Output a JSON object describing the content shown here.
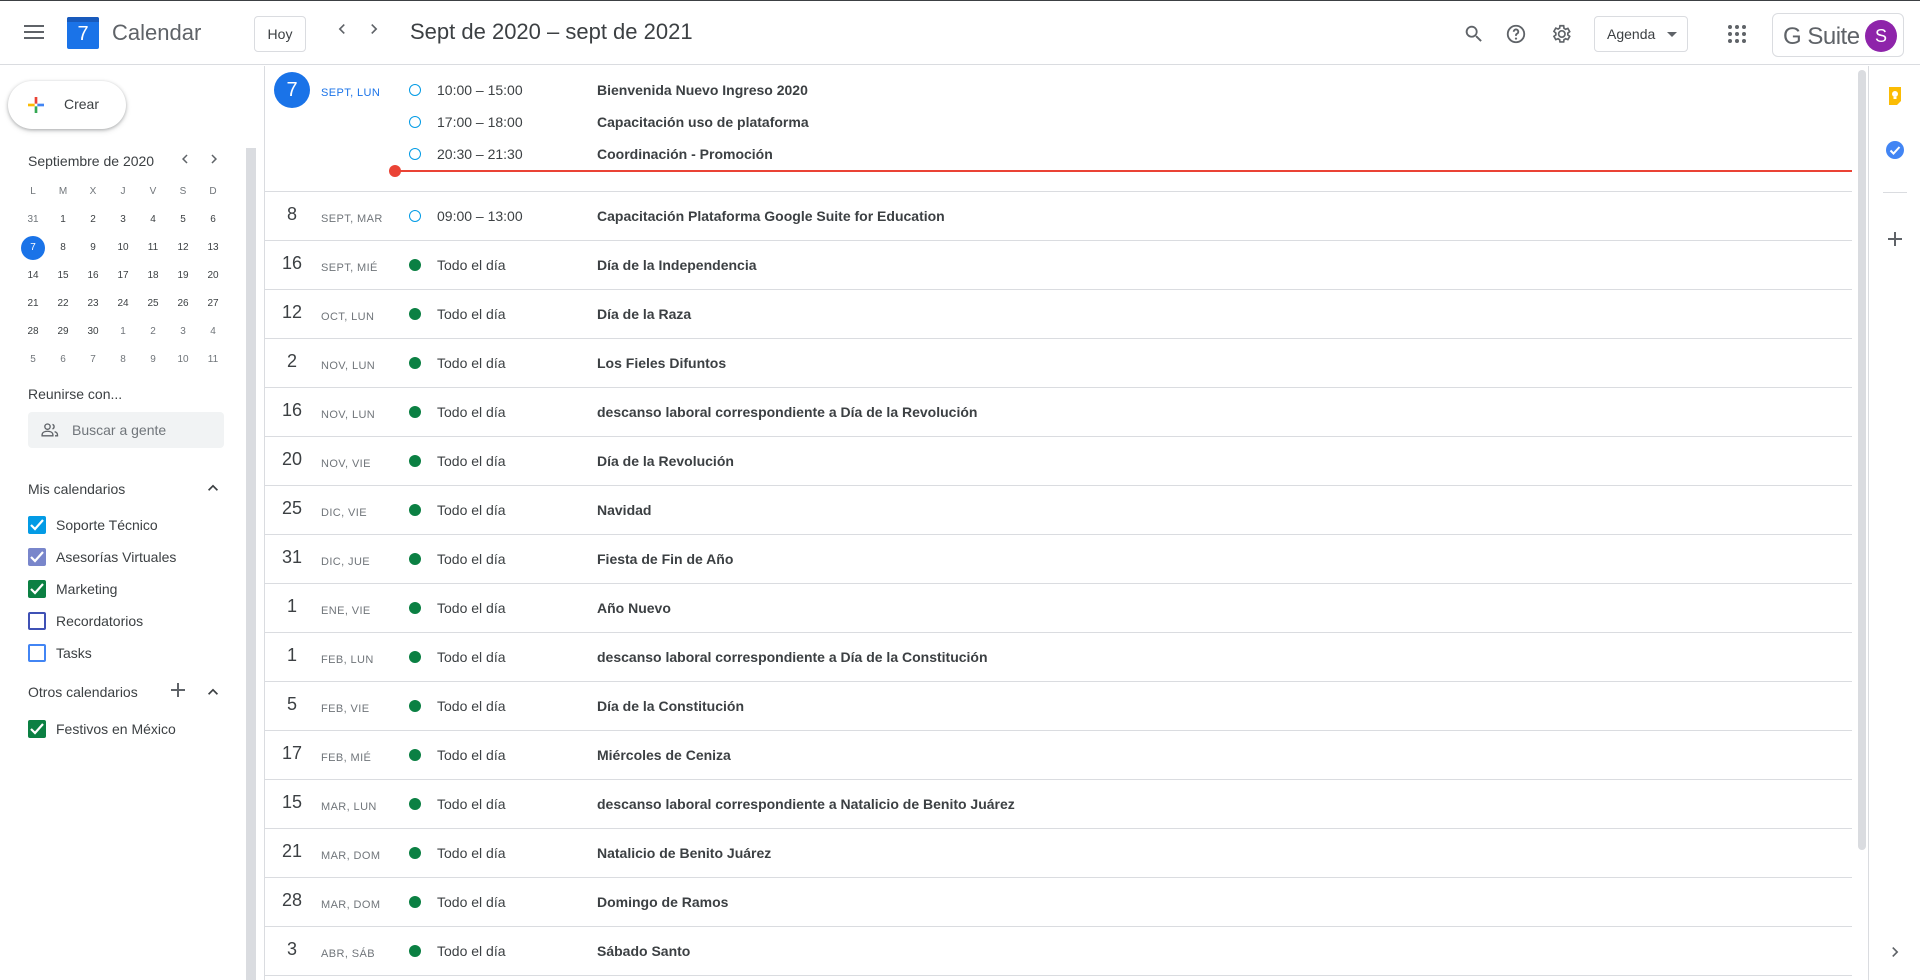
{
  "header": {
    "app_name": "Calendar",
    "logo_day": "7",
    "today_label": "Hoy",
    "date_range": "Sept de 2020 – sept de 2021",
    "view_label": "Agenda",
    "suite_brand": "G Suite",
    "avatar_initial": "S"
  },
  "sidebar": {
    "create_label": "Crear",
    "mini_calendar": {
      "title": "Septiembre de 2020",
      "weekdays": [
        "L",
        "M",
        "X",
        "J",
        "V",
        "S",
        "D"
      ],
      "weeks": [
        [
          "31",
          "1",
          "2",
          "3",
          "4",
          "5",
          "6"
        ],
        [
          "7",
          "8",
          "9",
          "10",
          "11",
          "12",
          "13"
        ],
        [
          "14",
          "15",
          "16",
          "17",
          "18",
          "19",
          "20"
        ],
        [
          "21",
          "22",
          "23",
          "24",
          "25",
          "26",
          "27"
        ],
        [
          "28",
          "29",
          "30",
          "1",
          "2",
          "3",
          "4"
        ],
        [
          "5",
          "6",
          "7",
          "8",
          "9",
          "10",
          "11"
        ]
      ]
    },
    "meet_title": "Reunirse con...",
    "search_people_placeholder": "Buscar a gente",
    "my_calendars_title": "Mis calendarios",
    "my_calendars": [
      {
        "label": "Soporte Técnico",
        "checked": true,
        "color": "#039be5"
      },
      {
        "label": "Asesorías Virtuales",
        "checked": true,
        "color": "#7986cb"
      },
      {
        "label": "Marketing",
        "checked": true,
        "color": "#0b8043"
      },
      {
        "label": "Recordatorios",
        "checked": false,
        "color": "#3f51b5"
      },
      {
        "label": "Tasks",
        "checked": false,
        "color": "#4285f4"
      }
    ],
    "other_calendars_title": "Otros calendarios",
    "other_calendars": [
      {
        "label": "Festivos en México",
        "checked": true,
        "color": "#0b8043"
      }
    ]
  },
  "agenda": {
    "days": [
      {
        "day": "7",
        "sub": "SEPT, LUN",
        "today": true,
        "events": [
          {
            "time": "10:00 – 15:00",
            "title": "Bienvenida Nuevo Ingreso 2020",
            "style": "ring"
          },
          {
            "time": "17:00 – 18:00",
            "title": "Capacitación uso de plataforma",
            "style": "ring"
          },
          {
            "time": "20:30 – 21:30",
            "title": "Coordinación - Promoción",
            "style": "ring"
          }
        ]
      },
      {
        "day": "8",
        "sub": "SEPT, MAR",
        "events": [
          {
            "time": "09:00 – 13:00",
            "title": "Capacitación Plataforma Google Suite for Education",
            "style": "ring"
          }
        ]
      },
      {
        "day": "16",
        "sub": "SEPT, MIÉ",
        "events": [
          {
            "time": "Todo el día",
            "title": "Día de la Independencia",
            "style": "fill"
          }
        ]
      },
      {
        "day": "12",
        "sub": "OCT, LUN",
        "events": [
          {
            "time": "Todo el día",
            "title": "Día de la Raza",
            "style": "fill"
          }
        ]
      },
      {
        "day": "2",
        "sub": "NOV, LUN",
        "events": [
          {
            "time": "Todo el día",
            "title": "Los Fieles Difuntos",
            "style": "fill"
          }
        ]
      },
      {
        "day": "16",
        "sub": "NOV, LUN",
        "events": [
          {
            "time": "Todo el día",
            "title": "descanso laboral correspondiente a Día de la Revolución",
            "style": "fill"
          }
        ]
      },
      {
        "day": "20",
        "sub": "NOV, VIE",
        "events": [
          {
            "time": "Todo el día",
            "title": "Día de la Revolución",
            "style": "fill"
          }
        ]
      },
      {
        "day": "25",
        "sub": "DIC, VIE",
        "events": [
          {
            "time": "Todo el día",
            "title": "Navidad",
            "style": "fill"
          }
        ]
      },
      {
        "day": "31",
        "sub": "DIC, JUE",
        "events": [
          {
            "time": "Todo el día",
            "title": "Fiesta de Fin de Año",
            "style": "fill"
          }
        ]
      },
      {
        "day": "1",
        "sub": "ENE, VIE",
        "events": [
          {
            "time": "Todo el día",
            "title": "Año Nuevo",
            "style": "fill"
          }
        ]
      },
      {
        "day": "1",
        "sub": "FEB, LUN",
        "events": [
          {
            "time": "Todo el día",
            "title": "descanso laboral correspondiente a Día de la Constitución",
            "style": "fill"
          }
        ]
      },
      {
        "day": "5",
        "sub": "FEB, VIE",
        "events": [
          {
            "time": "Todo el día",
            "title": "Día de la Constitución",
            "style": "fill"
          }
        ]
      },
      {
        "day": "17",
        "sub": "FEB, MIÉ",
        "events": [
          {
            "time": "Todo el día",
            "title": "Miércoles de Ceniza",
            "style": "fill"
          }
        ]
      },
      {
        "day": "15",
        "sub": "MAR, LUN",
        "events": [
          {
            "time": "Todo el día",
            "title": "descanso laboral correspondiente a Natalicio de Benito Juárez",
            "style": "fill"
          }
        ]
      },
      {
        "day": "21",
        "sub": "MAR, DOM",
        "events": [
          {
            "time": "Todo el día",
            "title": "Natalicio de Benito Juárez",
            "style": "fill"
          }
        ]
      },
      {
        "day": "28",
        "sub": "MAR, DOM",
        "events": [
          {
            "time": "Todo el día",
            "title": "Domingo de Ramos",
            "style": "fill"
          }
        ]
      },
      {
        "day": "3",
        "sub": "ABR, SÁB",
        "events": [
          {
            "time": "Todo el día",
            "title": "Sábado Santo",
            "style": "fill"
          }
        ]
      }
    ]
  },
  "colors": {
    "accent": "#1a73e8",
    "event_ring": "#039be5",
    "holiday": "#0b8043",
    "now_line": "#ea4335"
  }
}
